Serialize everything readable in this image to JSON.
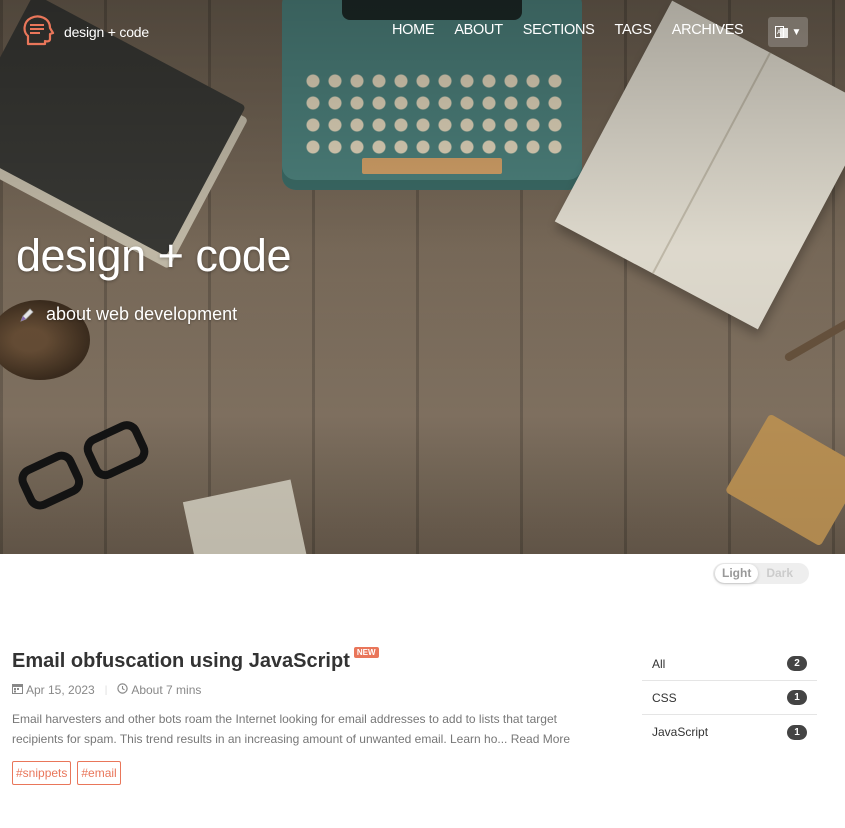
{
  "brand": {
    "name": "design + code",
    "logo_icon": "head-logo-icon"
  },
  "nav": {
    "items": [
      "HOME",
      "ABOUT",
      "SECTIONS",
      "TAGS",
      "ARCHIVES"
    ],
    "language_icon": "language-icon"
  },
  "hero": {
    "title": "design + code",
    "subtitle": "about web development",
    "subtitle_icon": "pen-icon"
  },
  "theme_toggle": {
    "light": "Light",
    "dark": "Dark",
    "selected": "Light"
  },
  "post": {
    "title": "Email obfuscation using JavaScript",
    "badge": "NEW",
    "date": "Apr 15, 2023",
    "read_time": "About 7 mins",
    "excerpt": "Email harvesters and other bots roam the Internet looking for email addresses to add to lists that target recipients for spam. This trend results in an increasing amount of unwanted email. Learn ho...",
    "read_more": "Read More",
    "tags": [
      "#snippets",
      "#email"
    ]
  },
  "sidebar": {
    "categories": [
      {
        "label": "All",
        "count": "2"
      },
      {
        "label": "CSS",
        "count": "1"
      },
      {
        "label": "JavaScript",
        "count": "1"
      }
    ]
  },
  "colors": {
    "accent": "#e9765a",
    "badge_dark": "#444444"
  }
}
